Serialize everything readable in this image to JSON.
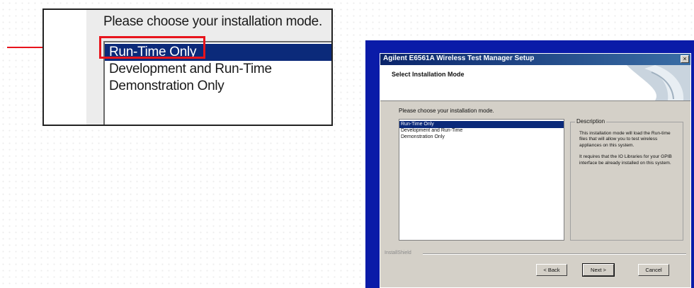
{
  "callout": {
    "prompt": "Please choose your installation mode.",
    "items": [
      {
        "label": "Run-Time Only",
        "selected": true
      },
      {
        "label": "Development and Run-Time",
        "selected": false
      },
      {
        "label": "Demonstration Only",
        "selected": false
      }
    ]
  },
  "dialog": {
    "title": "Agilent E6561A Wireless Test Manager Setup",
    "header_title": "Select Installation Mode",
    "prompt": "Please choose your installation mode.",
    "items": [
      {
        "label": "Run-Time Only",
        "selected": true
      },
      {
        "label": "Development and Run-Time",
        "selected": false
      },
      {
        "label": "Demonstration Only",
        "selected": false
      }
    ],
    "description": {
      "legend": "Description",
      "para1": "This installation mode will load the Run-time files that will allow you to test wireless appliances on this system.",
      "para2": "It requires that the IO Libraries for your GPIB interface be already installed on this system."
    },
    "footer_label": "InstallShield",
    "buttons": {
      "back": "< Back",
      "next": "Next >",
      "cancel": "Cancel"
    },
    "close_glyph": "×"
  },
  "colors": {
    "highlight": "#e8141c",
    "selection": "#0b2a7a",
    "desktop": "#0a1ba8"
  }
}
